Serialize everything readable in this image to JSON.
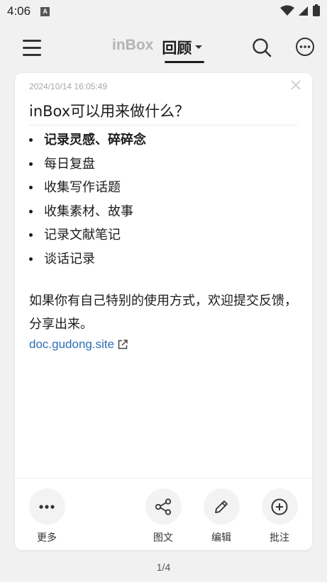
{
  "status_bar": {
    "time": "4:06",
    "app_badge": "A"
  },
  "header": {
    "tabs": [
      {
        "label": "inBox",
        "active": false
      },
      {
        "label": "回顾",
        "active": true
      }
    ]
  },
  "card": {
    "timestamp": "2024/10/14 16:05:49",
    "title": "inBox可以用来做什么？",
    "items": [
      "记录灵感、碎碎念",
      "每日复盘",
      "收集写作话题",
      "收集素材、故事",
      "记录文献笔记",
      "谈话记录"
    ],
    "paragraph": "如果你有自己特别的使用方式，欢迎提交反馈，分享出来。",
    "link": "doc.gudong.site"
  },
  "actions": {
    "more": "更多",
    "share_image": "图文",
    "edit": "编辑",
    "annotate": "批注"
  },
  "pager": "1/4",
  "colors": {
    "link": "#2d6fb6",
    "background": "#f1f1f1",
    "card": "#ffffff"
  }
}
